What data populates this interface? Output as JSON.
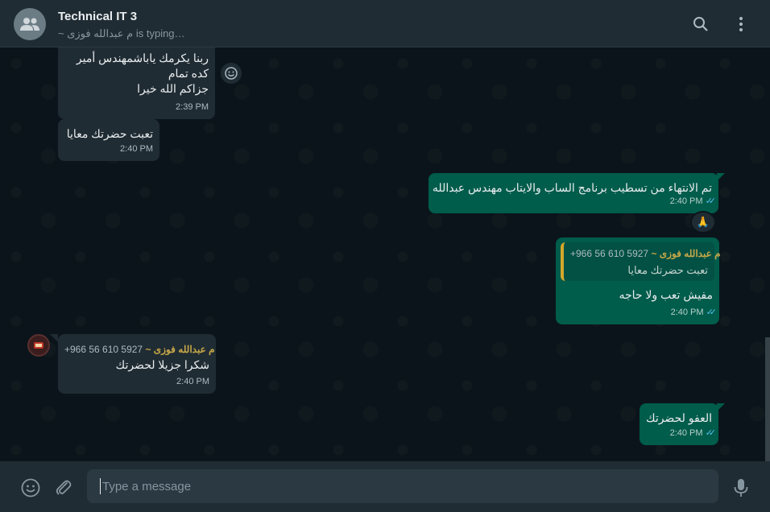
{
  "header": {
    "title": "Technical IT 3",
    "subtitle": "~ م عبدالله فوزى is typing…"
  },
  "messages": [
    {
      "lines": [
        "ربنا يكرمك ياباشمهندس أمير",
        "كده تمام",
        "جزاكم الله خيرا"
      ],
      "time": "2:39 PM"
    },
    {
      "text": "تعبت حضرتك معايا",
      "time": "2:40 PM"
    },
    {
      "text": "تم الانتهاء من تسطيب برنامج الساب والايتاب مهندس عبدالله",
      "time": "2:40 PM",
      "reaction": "🙏"
    },
    {
      "quote_sender": "~ م عبدالله فوزى",
      "quote_phone": "+966 56 610 5927",
      "quote_text": "تعبت حضرتك معايا",
      "text": "مفيش تعب ولا حاجه",
      "time": "2:40 PM"
    },
    {
      "sender": "~ م عبدالله فوزى",
      "phone": "+966 56 610 5927",
      "text": "شكرا جزيلا لحضرتك",
      "time": "2:40 PM"
    },
    {
      "text": "العفو لحضرتك",
      "time": "2:40 PM"
    }
  ],
  "composer": {
    "placeholder": "Type a message"
  },
  "icons": {
    "group": "group-icon",
    "search": "search-icon",
    "menu": "menu-icon",
    "emoji": "emoji-icon",
    "attach": "attach-icon",
    "mic": "mic-icon",
    "react": "react-icon",
    "ticks": "double-check-icon"
  },
  "colors": {
    "outgoing_bubble": "#005c4b",
    "incoming_bubble": "#202c33",
    "sender_name": "#c8a849",
    "read_tick": "#53bdeb"
  }
}
